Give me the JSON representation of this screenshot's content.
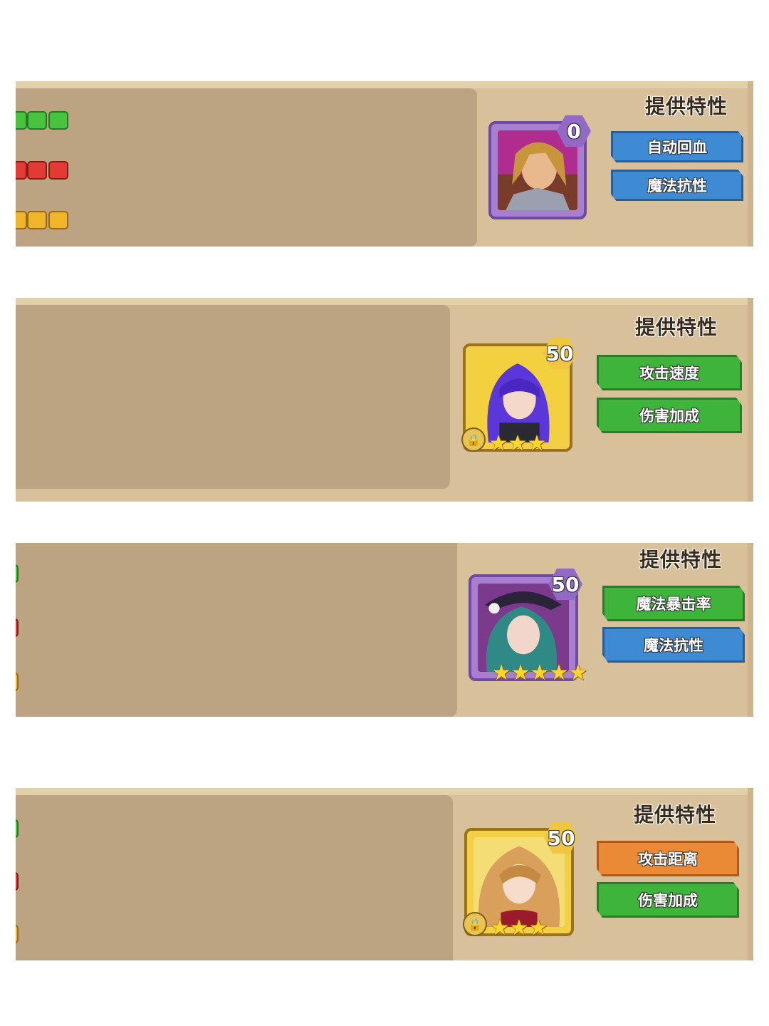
{
  "section_title": "提供特性",
  "cards": [
    {
      "level": "0",
      "frame": "purple",
      "stars": 0,
      "locked": false,
      "traits": [
        {
          "label": "自动回血",
          "color": "blue"
        },
        {
          "label": "魔法抗性",
          "color": "blue"
        }
      ]
    },
    {
      "level": "50",
      "frame": "gold",
      "stars": 3,
      "locked": true,
      "traits": [
        {
          "label": "攻击速度",
          "color": "green"
        },
        {
          "label": "伤害加成",
          "color": "green"
        }
      ]
    },
    {
      "level": "50",
      "frame": "purple",
      "stars": 5,
      "locked": false,
      "traits": [
        {
          "label": "魔法暴击率",
          "color": "green"
        },
        {
          "label": "魔法抗性",
          "color": "blue"
        }
      ]
    },
    {
      "level": "50",
      "frame": "gold",
      "stars": 3,
      "locked": true,
      "traits": [
        {
          "label": "攻击距离",
          "color": "orange"
        },
        {
          "label": "伤害加成",
          "color": "green"
        }
      ]
    }
  ],
  "colors": {
    "panel": "#d8c09a",
    "left_area": "#bca482",
    "trait_blue": "#3e8bd3",
    "trait_green": "#3fb43a",
    "trait_orange": "#ea8a36"
  }
}
